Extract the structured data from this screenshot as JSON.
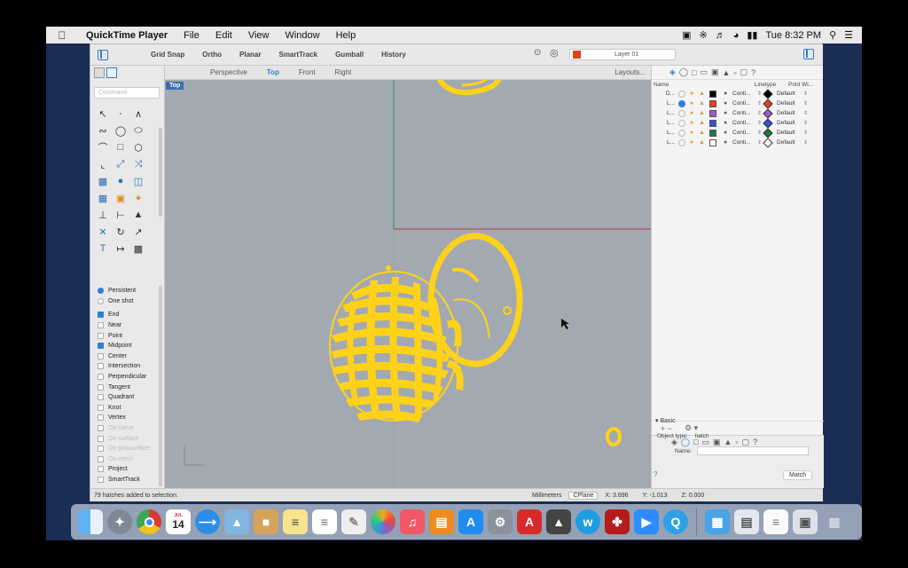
{
  "menubar": {
    "app_name": "QuickTime Player",
    "items": [
      "File",
      "Edit",
      "View",
      "Window",
      "Help"
    ],
    "clock": "Tue 8:32 PM",
    "icons": [
      "camera-icon",
      "bluetooth-icon",
      "volume-icon",
      "wifi-icon",
      "battery-icon",
      "search-icon",
      "list-icon"
    ]
  },
  "rhino": {
    "toolbar": [
      "Grid Snap",
      "Ortho",
      "Planar",
      "SmartTrack",
      "Gumball",
      "History"
    ],
    "current_layer": "Layer 01",
    "current_layer_color": "#e2401f",
    "view_tabs": [
      "Perspective",
      "Top",
      "Front",
      "Right"
    ],
    "active_view": "Top",
    "layouts": "Layouts...",
    "viewport_label": "Top",
    "command_placeholder": "Command",
    "osnap": {
      "persistent": "Persistent",
      "one_shot": "One shot",
      "items": [
        {
          "label": "End",
          "checked": true,
          "enabled": true
        },
        {
          "label": "Near",
          "checked": false,
          "enabled": true
        },
        {
          "label": "Point",
          "checked": false,
          "enabled": true
        },
        {
          "label": "Midpoint",
          "checked": true,
          "enabled": true
        },
        {
          "label": "Center",
          "checked": false,
          "enabled": true
        },
        {
          "label": "Intersection",
          "checked": false,
          "enabled": true
        },
        {
          "label": "Perpendicular",
          "checked": false,
          "enabled": true
        },
        {
          "label": "Tangent",
          "checked": false,
          "enabled": true
        },
        {
          "label": "Quadrant",
          "checked": false,
          "enabled": true
        },
        {
          "label": "Knot",
          "checked": false,
          "enabled": true
        },
        {
          "label": "Vertex",
          "checked": false,
          "enabled": true
        },
        {
          "label": "On curve",
          "checked": false,
          "enabled": false
        },
        {
          "label": "On surface",
          "checked": false,
          "enabled": false
        },
        {
          "label": "On polysurface",
          "checked": false,
          "enabled": false
        },
        {
          "label": "On mesh",
          "checked": false,
          "enabled": false
        },
        {
          "label": "Project",
          "checked": false,
          "enabled": true
        },
        {
          "label": "SmartTrack",
          "checked": false,
          "enabled": true
        }
      ]
    },
    "layers_panel": {
      "columns": {
        "name": "Name",
        "linetype": "Linetype",
        "print_width": "Print Wi..."
      },
      "rows": [
        {
          "name": "D...",
          "current": false,
          "color": "#000000",
          "linetype": "Conti...",
          "print": "Default",
          "diamond": "#000000"
        },
        {
          "name": "L...",
          "current": true,
          "color": "#e2401f",
          "linetype": "Conti...",
          "print": "Default",
          "diamond": "#e2401f"
        },
        {
          "name": "L...",
          "current": false,
          "color": "#a259c8",
          "linetype": "Conti...",
          "print": "Default",
          "diamond": "#a259c8"
        },
        {
          "name": "L...",
          "current": false,
          "color": "#2f55d3",
          "linetype": "Conti...",
          "print": "Default",
          "diamond": "#2f55d3"
        },
        {
          "name": "L...",
          "current": false,
          "color": "#1f7a3a",
          "linetype": "Conti...",
          "print": "Default",
          "diamond": "#1f7a3a"
        },
        {
          "name": "L...",
          "current": false,
          "color": "#ffffff",
          "linetype": "Conti...",
          "print": "Default",
          "diamond": "#ffffff"
        }
      ]
    },
    "properties": {
      "section": "Basic",
      "object_type_label": "Object type:",
      "object_type": "hatch",
      "name_label": "Name:",
      "match": "Match"
    },
    "status": {
      "message": "79 hatches added to selection.",
      "units": "Millimeters",
      "cplane": "CPlane",
      "x": "X: 3.696",
      "y": "Y: -1.013",
      "z": "Z: 0.000"
    }
  },
  "colors": {
    "accent": "#2f7fd3",
    "hatch": "#ffd21a",
    "viewport_bg": "#a3a9b1"
  },
  "dock": {
    "calendar_day": "14",
    "calendar_month": "JUL",
    "apps": [
      "finder-icon",
      "launchpad-icon",
      "chrome-icon",
      "calendar-icon",
      "safari-icon",
      "preview-icon",
      "notes-icon",
      "reminders-icon",
      "photos-icon",
      "music-icon",
      "books-icon",
      "app-store-icon",
      "system-preferences-icon",
      "autocad-icon",
      "rhino-icon",
      "word-w-icon",
      "acrobat-icon",
      "zoom-icon",
      "quicktime-icon",
      "folder-icon",
      "files-icon",
      "trash-icon"
    ]
  }
}
